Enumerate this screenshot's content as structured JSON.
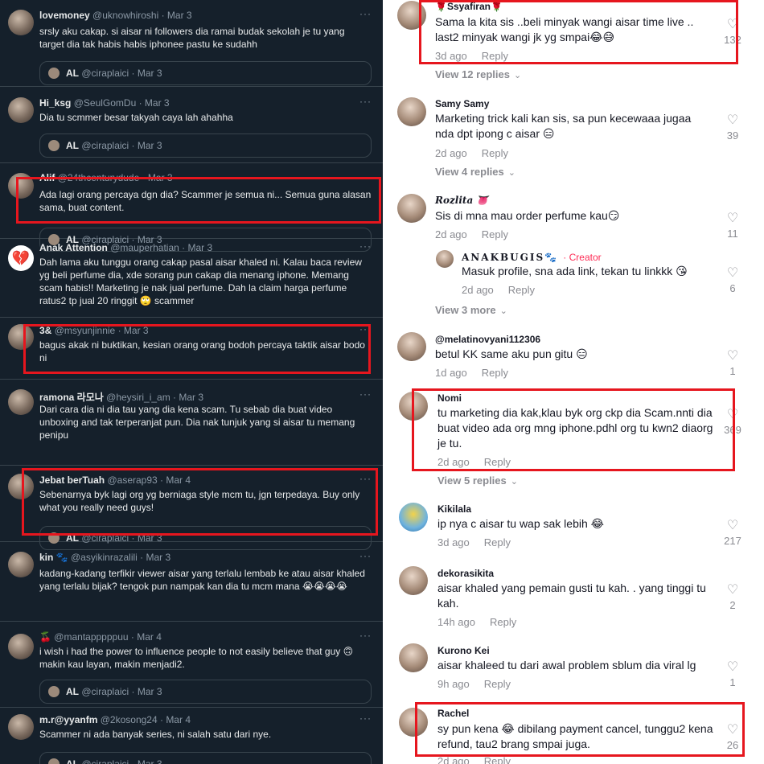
{
  "twitter": {
    "more_label": "···",
    "quote_name": "AL",
    "quote_handle": "@ciraplaici · Mar 3",
    "tweets": [
      {
        "name": "lovemoney",
        "meta": "@uknowhiroshi · Mar 3",
        "text": "srsly aku cakap. si aisar ni followers dia ramai budak sekolah je tu yang target dia tak habis habis iphonee pastu ke sudahh"
      },
      {
        "name": "Hi_ksg",
        "meta": "@SeulGomDu · Mar 3",
        "text": "Dia tu scmmer besar takyah caya lah ahahha"
      },
      {
        "name": "Alif",
        "meta": "@24thcenturydude · Mar 3",
        "text": "Ada lagi orang percaya dgn dia? Scammer je semua ni... Semua guna alasan sama, buat content."
      },
      {
        "name": "Anak Attention",
        "meta": "@mauperhatian · Mar 3",
        "text": "Dah lama aku tunggu orang cakap pasal aisar khaled ni. Kalau baca review yg beli perfume dia, xde sorang pun cakap dia menang iphone. Memang scam habis!! Marketing je nak jual perfume. Dah la claim harga perfume ratus2 tp jual 20 ringgit 🙄 scammer"
      },
      {
        "name": "3&",
        "meta": "@msyunjinnie · Mar 3",
        "text": "bagus akak ni buktikan, kesian orang orang bodoh percaya taktik aisar bodo ni"
      },
      {
        "name": "ramona 라모나",
        "meta": "@heysiri_i_am · Mar 3",
        "text": "Dari cara dia ni dia tau yang dia kena scam. Tu sebab dia buat video unboxing and tak terperanjat pun. Dia nak tunjuk yang si aisar tu memang penipu"
      },
      {
        "name": "Jebat berTuah",
        "meta": "@aserap93 · Mar 4",
        "text": "Sebenarnya byk lagi org yg berniaga style mcm tu, jgn terpedaya. Buy only what you really need guys!"
      },
      {
        "name": "kin 🐾",
        "meta": "@asyikinrazalili · Mar 3",
        "text": "kadang-kadang terfikir viewer aisar yang terlalu lembab ke atau aisar khaled yang  terlalu bijak? tengok pun nampak kan dia tu mcm mana 😭😭😭😭"
      },
      {
        "name": "🍒",
        "meta": "@mantapppppuu · Mar 4",
        "text": "i wish i had the power to influence people to not easily believe that guy 🙃 makin kau layan, makin menjadi2."
      },
      {
        "name": "m.r@yyanfm",
        "meta": "@2kosong24 · Mar 4",
        "text": "Scammer ni ada banyak series, ni salah satu dari nye."
      }
    ]
  },
  "tiktok": {
    "heart_icon": "♡",
    "reply_label": "Reply",
    "comments": [
      {
        "name": "🌹Ssyafiran🌹",
        "text": "Sama la kita sis ..beli minyak wangi aisar time live .. last2 minyak wangi jk yg smpai😂😅",
        "time": "3d ago",
        "likes": "132"
      },
      {
        "name": "Samy Samy",
        "text": "Marketing trick kali kan sis, sa pun kecewaaa jugaa nda dpt ipong c aisar 😑",
        "time": "2d ago",
        "likes": "39"
      },
      {
        "name": "Rozlita 👅",
        "text": "Sis di mna mau order perfume kau😏",
        "time": "2d ago",
        "likes": "11"
      },
      {
        "name": "ANAKBUGIS🐾",
        "creator": "· Creator",
        "text": "Masuk profile, sna ada link, tekan tu linkkk 😘",
        "time": "2d ago",
        "likes": "6"
      },
      {
        "name": "@melatinovyani112306",
        "text": "betul KK same aku pun gitu 😑",
        "time": "1d ago",
        "likes": "1"
      },
      {
        "name": "Nomi",
        "text": "tu marketing dia kak,klau byk org ckp dia Scam.nnti dia buat video ada org mng iphone.pdhl org tu kwn2 diaorg je tu.",
        "time": "2d ago",
        "likes": "369"
      },
      {
        "name": "Kikilala",
        "text": "ip nya c aisar tu wap sak lebih 😂",
        "time": "3d ago",
        "likes": "217"
      },
      {
        "name": "dekorasikita",
        "text": "aisar khaled yang pemain gusti tu kah. . yang tinggi tu kah.",
        "time": "14h ago",
        "likes": "2"
      },
      {
        "name": "Kurono Kei",
        "text": "aisar khaleed tu dari awal problem sblum dia viral lg",
        "time": "9h ago",
        "likes": "1"
      },
      {
        "name": "Rachel",
        "text": "sy pun kena 😂 dibilang payment cancel, tunggu2 kena refund, tau2 brang smpai juga.",
        "time": "2d ago",
        "likes": "26"
      }
    ],
    "view_replies": [
      "View 12 replies",
      "View 4 replies",
      "View 3 more",
      "View 5 replies"
    ]
  }
}
